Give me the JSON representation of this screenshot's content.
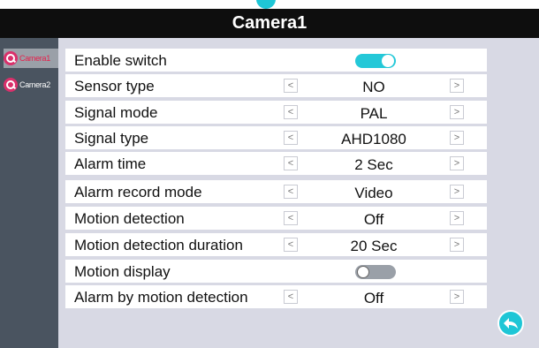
{
  "title": "Camera1",
  "sidebar": {
    "items": [
      {
        "label": "Camera1",
        "icon": "camera-search-icon",
        "active": true
      },
      {
        "label": "Camera2",
        "icon": "camera-search-icon",
        "active": false
      }
    ]
  },
  "settings": [
    {
      "label": "Enable switch",
      "control": "toggle",
      "state": "on"
    },
    {
      "label": "Sensor type",
      "value": "NO",
      "prev": "<",
      "next": ">"
    },
    {
      "label": "Signal mode",
      "value": "PAL",
      "prev": "<",
      "next": ">"
    },
    {
      "label": "Signal type",
      "value": "AHD1080",
      "prev": "<",
      "next": ">"
    },
    {
      "label": "Alarm time",
      "value": "2 Sec",
      "prev": "<",
      "next": ">"
    },
    {
      "label": "Alarm record mode",
      "value": "Video",
      "prev": "<",
      "next": ">"
    },
    {
      "label": "Motion detection",
      "value": "Off",
      "prev": "<",
      "next": ">"
    },
    {
      "label": "Motion detection duration",
      "value": "20 Sec",
      "prev": "<",
      "next": ">"
    },
    {
      "label": "Motion display",
      "control": "toggle",
      "state": "off"
    },
    {
      "label": "Alarm by motion detection",
      "value": "Off",
      "prev": "<",
      "next": ">"
    }
  ],
  "colors": {
    "accent": "#1ec6d6",
    "title_bar": "#0e0e0e",
    "sidebar": "#4a5460",
    "panel": "#d8d9e4",
    "camera_icon": "#d9306b",
    "active_label": "#e81e4a"
  },
  "back_icon": "back-arrow-icon"
}
